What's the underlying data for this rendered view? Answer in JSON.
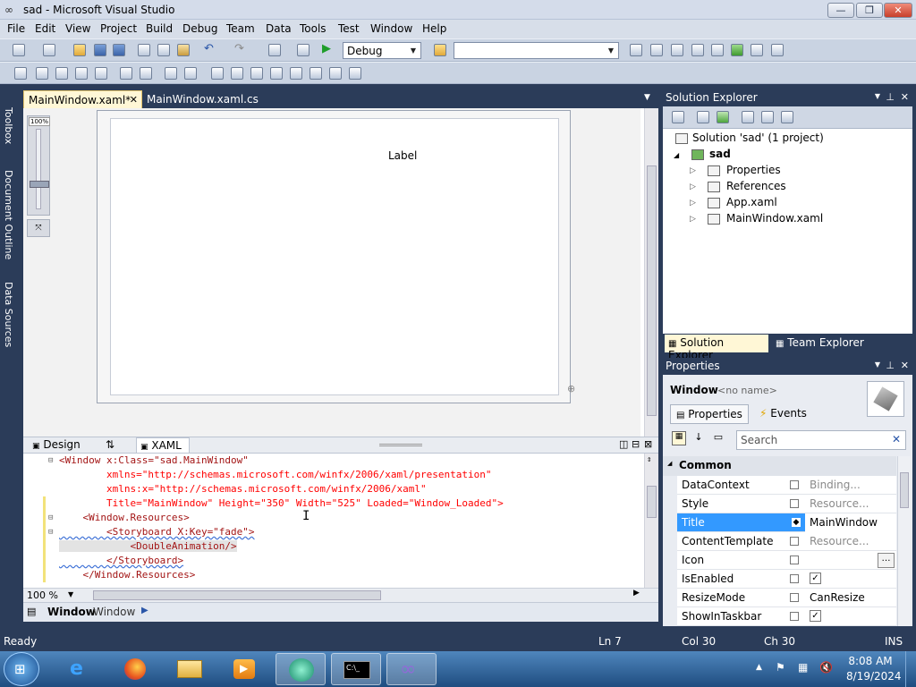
{
  "window": {
    "title": "sad - Microsoft Visual Studio"
  },
  "menu": [
    "File",
    "Edit",
    "View",
    "Project",
    "Build",
    "Debug",
    "Team",
    "Data",
    "Tools",
    "Test",
    "Window",
    "Help"
  ],
  "toolbar": {
    "config_value": "Debug",
    "platform_value": ""
  },
  "left_tabs": [
    "Toolbox",
    "Document Outline",
    "Data Sources"
  ],
  "doc_tabs": [
    {
      "label": "MainWindow.xaml*",
      "active": true
    },
    {
      "label": "MainWindow.xaml.cs",
      "active": false
    }
  ],
  "designer": {
    "zoom_label": "100%",
    "label_text": "Label"
  },
  "split": {
    "design_label": "Design",
    "xaml_label": "XAML"
  },
  "code_lines": [
    {
      "text": "<Window x:Class=\"sad.MainWindow\""
    },
    {
      "text": "        xmlns=\"http://schemas.microsoft.com/winfx/2006/xaml/presentation\""
    },
    {
      "text": "        xmlns:x=\"http://schemas.microsoft.com/winfx/2006/xaml\""
    },
    {
      "text": "        Title=\"MainWindow\" Height=\"350\" Width=\"525\" Loaded=\"Window_Loaded\">"
    },
    {
      "text": "    <Window.Resources>"
    },
    {
      "text": "        <Storyboard X:Key=\"fade\">"
    },
    {
      "text": "            <DoubleAnimation/>"
    },
    {
      "text": "        </Storyboard>"
    },
    {
      "text": "    </Window.Resources>"
    }
  ],
  "code_zoom": "100 %",
  "breadcrumb": {
    "element": "Window",
    "type": "Window"
  },
  "solution_explorer": {
    "title": "Solution Explorer",
    "solution": "Solution 'sad' (1 project)",
    "project": "sad",
    "items": [
      "Properties",
      "References",
      "App.xaml",
      "MainWindow.xaml"
    ],
    "bottom_tabs": [
      "Solution Explorer",
      "Team Explorer"
    ]
  },
  "properties": {
    "title": "Properties",
    "object_type": "Window",
    "object_name": "<no name>",
    "tabs": [
      "Properties",
      "Events"
    ],
    "search_placeholder": "Search",
    "category": "Common",
    "rows": [
      {
        "name": "DataContext",
        "value": "Binding...",
        "selected": false,
        "grey": true
      },
      {
        "name": "Style",
        "value": "Resource...",
        "selected": false,
        "grey": true
      },
      {
        "name": "Title",
        "value": "MainWindow",
        "selected": true,
        "grey": false
      },
      {
        "name": "ContentTemplate",
        "value": "Resource...",
        "selected": false,
        "grey": true
      },
      {
        "name": "Icon",
        "value": "",
        "selected": false,
        "grey": false
      },
      {
        "name": "IsEnabled",
        "value": "✓",
        "selected": false,
        "grey": false
      },
      {
        "name": "ResizeMode",
        "value": "CanResize",
        "selected": false,
        "grey": false
      },
      {
        "name": "ShowInTaskbar",
        "value": "✓",
        "selected": false,
        "grey": false
      }
    ]
  },
  "status": {
    "ready": "Ready",
    "ln": "Ln 7",
    "col": "Col 30",
    "ch": "Ch 30",
    "ins": "INS"
  },
  "clock": {
    "time": "8:08 AM",
    "date": "8/19/2024"
  }
}
